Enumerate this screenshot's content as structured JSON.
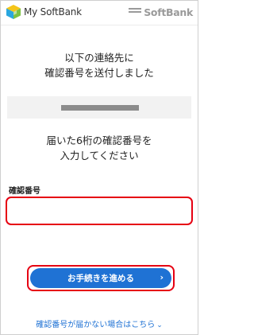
{
  "header": {
    "app_name": "My SoftBank",
    "brand_name": "SoftBank",
    "app_logo_icon": "cube-logo-icon",
    "brand_icon": "softbank-bars-icon"
  },
  "message_sent": {
    "line1": "以下の連絡先に",
    "line2": "確認番号を送付しました"
  },
  "message_enter": {
    "line1": "届いた6桁の確認番号を",
    "line2": "入力してください"
  },
  "form": {
    "code_label": "確認番号",
    "code_value": "",
    "submit_label": "お手続きを進める",
    "submit_icon": "chevron-right-icon"
  },
  "help_link": {
    "label": "確認番号が届かない場合はこちら",
    "icon": "chevron-down-icon"
  },
  "colors": {
    "accent_blue": "#1f72d4",
    "highlight_red": "#e60012"
  }
}
